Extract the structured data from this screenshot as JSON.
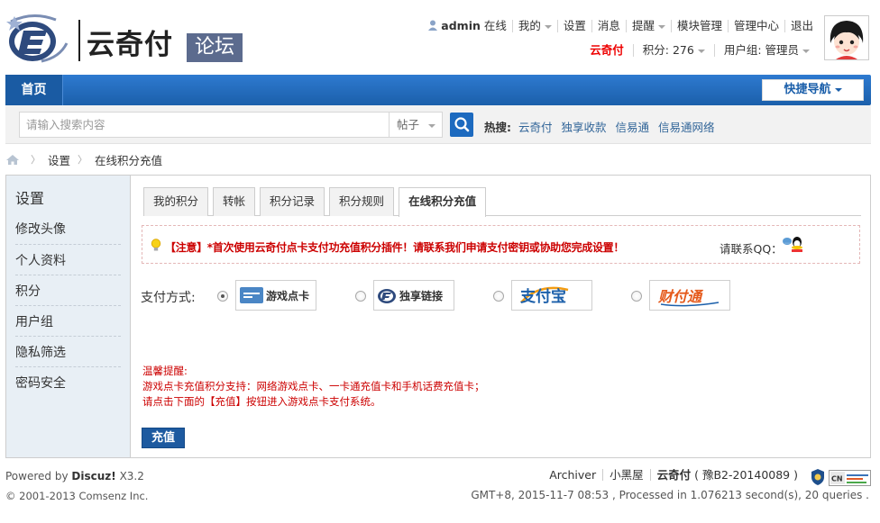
{
  "header": {
    "logo_text": "云奇付",
    "logo_badge": "论坛",
    "user_nav": {
      "username": "admin",
      "status": "在线",
      "items": [
        "我的",
        "设置",
        "消息",
        "提醒",
        "模块管理",
        "管理中心",
        "退出"
      ]
    },
    "user_info": {
      "site_name": "云奇付",
      "credits": "积分: 276",
      "group": "用户组: 管理员"
    }
  },
  "navbar": {
    "home": "首页",
    "quick_nav": "快捷导航"
  },
  "search": {
    "placeholder": "请输入搜索内容",
    "type": "帖子",
    "hot_label": "热搜:",
    "hot_links": [
      "云奇付",
      "独享收款",
      "信易通",
      "信易通网络"
    ]
  },
  "breadcrumb": [
    "设置",
    "在线积分充值"
  ],
  "sidebar": {
    "title": "设置",
    "items": [
      "修改头像",
      "个人资料",
      "积分",
      "用户组",
      "隐私筛选",
      "密码安全"
    ]
  },
  "tabs": [
    "我的积分",
    "转帐",
    "积分记录",
    "积分规则",
    "在线积分充值"
  ],
  "active_tab": "在线积分充值",
  "notice": {
    "message": "【注意】*首次使用云奇付点卡支付功充值积分插件！请联系我们申请支付密钥或协助您完成设置！",
    "contact": "请联系QQ："
  },
  "payment": {
    "label": "支付方式:",
    "options": [
      {
        "name": "游戏点卡",
        "checked": true
      },
      {
        "name": "独享链接",
        "checked": false
      },
      {
        "name": "支付宝",
        "checked": false
      },
      {
        "name": "财付通",
        "checked": false
      }
    ]
  },
  "tips": {
    "title": "温馨提醒:",
    "line1": "游戏点卡充值积分支持：网络游戏点卡、一卡通充值卡和手机话费充值卡；",
    "line2": "请点击下面的【充值】按钮进入游戏点卡支付系统。"
  },
  "recharge_button": "充值",
  "footer": {
    "powered_prefix": "Powered by",
    "powered_name": "Discuz!",
    "powered_version": "X3.2",
    "copyright": "© 2001-2013 Comsenz Inc.",
    "links": [
      "Archiver",
      "小黑屋"
    ],
    "site": "云奇付",
    "icp": "( 豫B2-20140089 )",
    "stats": "GMT+8, 2015-11-7 08:53 , Processed in 1.076213 second(s), 20 queries ."
  },
  "colors": {
    "nav_blue": "#1b5faa",
    "notice_red": "#cc0000",
    "sidebar_bg": "#e8eff5"
  }
}
